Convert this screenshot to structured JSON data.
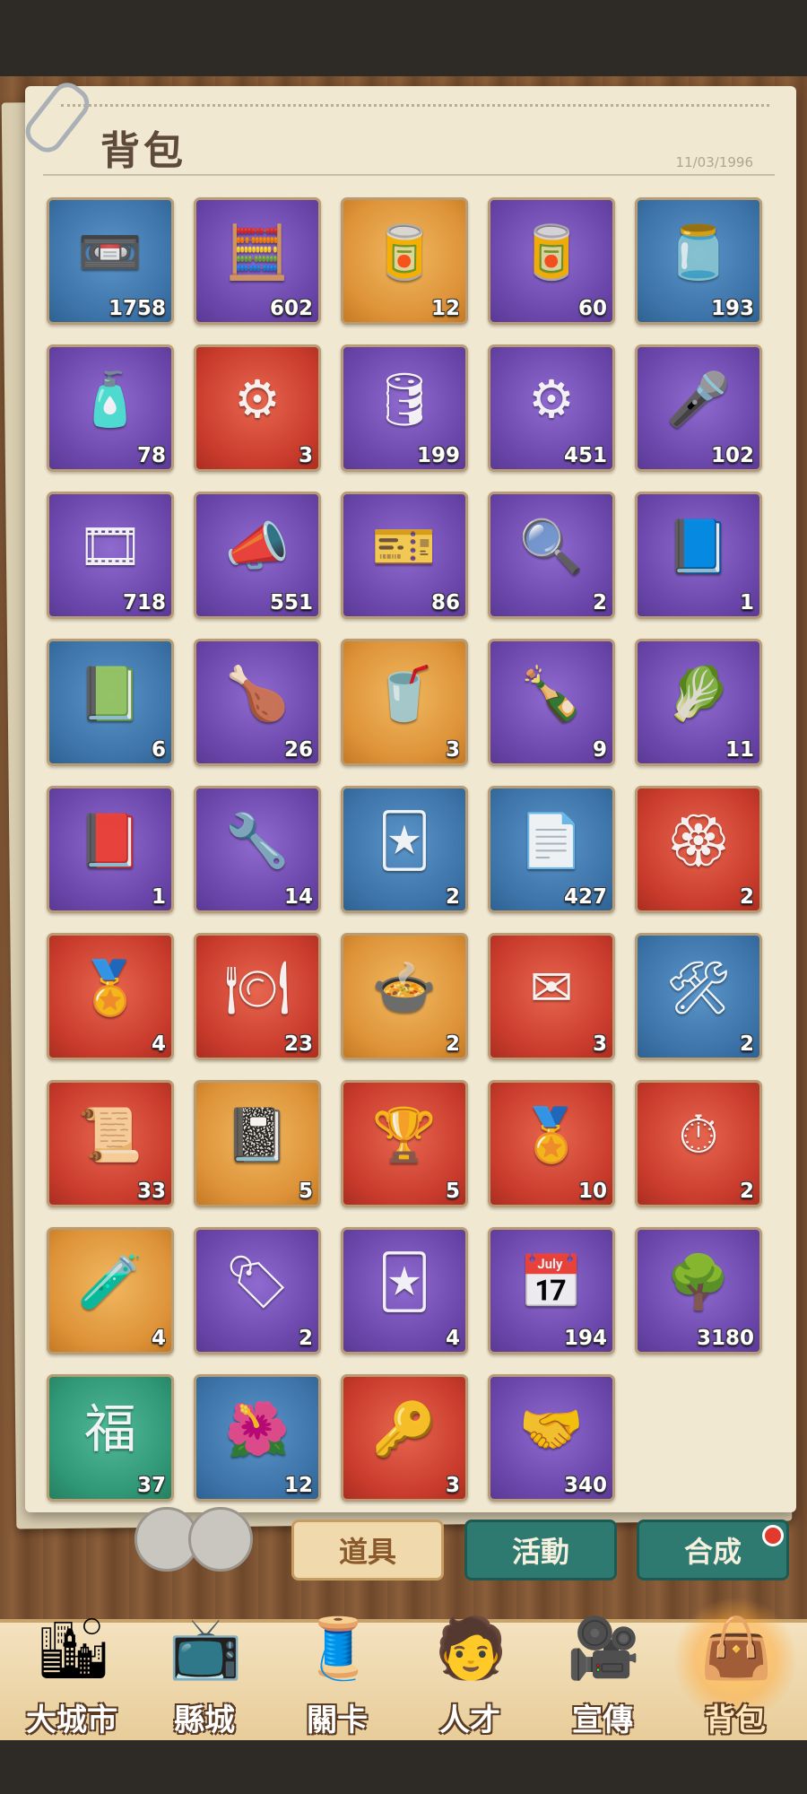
{
  "header": {
    "title": "背包",
    "date": "11/03/1996"
  },
  "items": [
    {
      "icon": "cassette-tape-icon",
      "glyph": "📼",
      "bg": "blue",
      "count": "1758"
    },
    {
      "icon": "calculator-icon",
      "glyph": "🧮",
      "bg": "purple",
      "count": "602"
    },
    {
      "icon": "cream-tin-icon",
      "glyph": "🥫",
      "bg": "gold",
      "count": "12"
    },
    {
      "icon": "cosmetic-tin-icon",
      "glyph": "🥫",
      "bg": "purple",
      "count": "60"
    },
    {
      "icon": "cream-jar-icon",
      "glyph": "🫙",
      "bg": "blue",
      "count": "193"
    },
    {
      "icon": "spray-bottle-icon",
      "glyph": "🧴",
      "bg": "purple",
      "count": "78"
    },
    {
      "icon": "turbocharger-icon",
      "glyph": "⚙",
      "bg": "red",
      "count": "3"
    },
    {
      "icon": "oil-canister-icon",
      "glyph": "🛢",
      "bg": "purple",
      "count": "199"
    },
    {
      "icon": "gear-icon",
      "glyph": "⚙",
      "bg": "purple",
      "count": "451"
    },
    {
      "icon": "microphone-icon",
      "glyph": "🎤",
      "bg": "purple",
      "count": "102"
    },
    {
      "icon": "film-reel-icon",
      "glyph": "🎞",
      "bg": "purple",
      "count": "718"
    },
    {
      "icon": "megaphone-icon",
      "glyph": "📣",
      "bg": "purple",
      "count": "551"
    },
    {
      "icon": "ticket-icon",
      "glyph": "🎫",
      "bg": "purple",
      "count": "86"
    },
    {
      "icon": "magnifying-glass-icon",
      "glyph": "🔍",
      "bg": "purple",
      "count": "2"
    },
    {
      "icon": "contract-book-icon",
      "glyph": "📘",
      "bg": "purple",
      "count": "1"
    },
    {
      "icon": "contract-book-icon",
      "glyph": "📗",
      "bg": "blue",
      "count": "6"
    },
    {
      "icon": "drumstick-icon",
      "glyph": "🍗",
      "bg": "purple",
      "count": "26"
    },
    {
      "icon": "iced-drink-icon",
      "glyph": "🥤",
      "bg": "gold",
      "count": "3"
    },
    {
      "icon": "soda-bottle-icon",
      "glyph": "🍾",
      "bg": "purple",
      "count": "9"
    },
    {
      "icon": "vegetable-plate-icon",
      "glyph": "🥬",
      "bg": "purple",
      "count": "11"
    },
    {
      "icon": "challenge-card-icon",
      "glyph": "📕",
      "bg": "purple",
      "count": "1"
    },
    {
      "icon": "repair-card-icon",
      "glyph": "🔧",
      "bg": "purple",
      "count": "14"
    },
    {
      "icon": "stomp-card-icon",
      "glyph": "🃏",
      "bg": "blue",
      "count": "2"
    },
    {
      "icon": "document-icon",
      "glyph": "📄",
      "bg": "blue",
      "count": "427"
    },
    {
      "icon": "flower-medal-icon",
      "glyph": "🏵",
      "bg": "red",
      "count": "2"
    },
    {
      "icon": "badge-emblem-icon",
      "glyph": "🏅",
      "bg": "red",
      "count": "4"
    },
    {
      "icon": "jade-plate-icon",
      "glyph": "🍽",
      "bg": "red",
      "count": "23"
    },
    {
      "icon": "food-bowl-icon",
      "glyph": "🍲",
      "bg": "gold",
      "count": "2"
    },
    {
      "icon": "invitation-letter-icon",
      "glyph": "✉",
      "bg": "red",
      "count": "3"
    },
    {
      "icon": "tool-roll-icon",
      "glyph": "🛠",
      "bg": "blue",
      "count": "2"
    },
    {
      "icon": "scroll-icon",
      "glyph": "📜",
      "bg": "red",
      "count": "33"
    },
    {
      "icon": "dragon-book-icon",
      "glyph": "📓",
      "bg": "gold",
      "count": "5"
    },
    {
      "icon": "emblem-puzzle-icon",
      "glyph": "🏆",
      "bg": "red",
      "count": "5"
    },
    {
      "icon": "badge-puzzle-icon",
      "glyph": "🏅",
      "bg": "red",
      "count": "10"
    },
    {
      "icon": "pocket-watch-icon",
      "glyph": "⏱",
      "bg": "red",
      "count": "2"
    },
    {
      "icon": "green-flask-icon",
      "glyph": "🧪",
      "bg": "gold",
      "count": "4"
    },
    {
      "icon": "rename-card-icon",
      "glyph": "🏷",
      "bg": "purple",
      "count": "2"
    },
    {
      "icon": "gold-card-icon",
      "glyph": "🃏",
      "bg": "purple",
      "count": "4"
    },
    {
      "icon": "calendar-page-icon",
      "glyph": "📅",
      "bg": "purple",
      "count": "194"
    },
    {
      "icon": "bonsai-icon",
      "glyph": "🌳",
      "bg": "purple",
      "count": "3180"
    },
    {
      "icon": "fortune-fu-icon",
      "glyph": "福",
      "bg": "green",
      "count": "37"
    },
    {
      "icon": "red-flower-icon",
      "glyph": "🌺",
      "bg": "blue",
      "count": "12"
    },
    {
      "icon": "key-tag-icon",
      "glyph": "🔑",
      "bg": "red",
      "count": "3"
    },
    {
      "icon": "handshake-card-icon",
      "glyph": "🤝",
      "bg": "purple",
      "count": "340"
    }
  ],
  "tabs": [
    {
      "label": "道具",
      "active": true
    },
    {
      "label": "活動",
      "active": false
    },
    {
      "label": "合成",
      "active": false
    }
  ],
  "nav": [
    {
      "label": "大城市",
      "icon": "city-buildings-icon",
      "glyph": "🏙"
    },
    {
      "label": "縣城",
      "icon": "television-icon",
      "glyph": "📺"
    },
    {
      "label": "關卡",
      "icon": "sewing-machine-icon",
      "glyph": "🧵"
    },
    {
      "label": "人才",
      "icon": "person-icon",
      "glyph": "🧑"
    },
    {
      "label": "宣傳",
      "icon": "film-camera-icon",
      "glyph": "🎥"
    },
    {
      "label": "背包",
      "icon": "backpack-bag-icon",
      "glyph": "👜"
    }
  ],
  "colors": {
    "purple": "#6a46aa",
    "blue": "#3c73a8",
    "gold": "#dd9238",
    "red": "#c93b2c",
    "green": "#2f9676",
    "accent": "#2f7a70"
  }
}
